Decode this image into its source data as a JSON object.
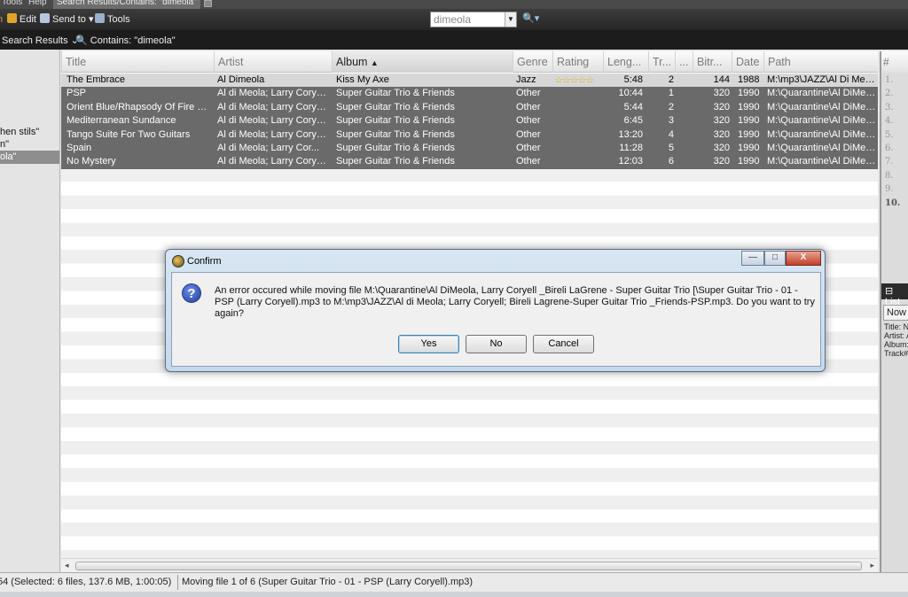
{
  "menubar": {
    "items": [
      "Tools",
      "Help"
    ],
    "active_tab": "Search Results/Contains: \"dimeola\""
  },
  "toolbar": {
    "edit": "Edit",
    "send_to": "Send to",
    "tools": "Tools",
    "search_value": "dimeola"
  },
  "breadcrumb": {
    "search_results": "Search Results",
    "contains": "Contains: \"dimeola\""
  },
  "tree": {
    "items": [
      "hen stils\"",
      "n\"",
      "ola\""
    ]
  },
  "columns": [
    "Title",
    "Artist",
    "Album",
    "Genre",
    "Rating",
    "Leng...",
    "Tr...",
    "...",
    "Bitr...",
    "Date",
    "Path"
  ],
  "tracks": [
    {
      "title": "The Embrace",
      "artist": "Al Dimeola",
      "album": "Kiss My Axe",
      "genre": "Jazz",
      "rating": "☆☆☆☆☆",
      "length": "5:48",
      "track": "2",
      "bitrate": "144",
      "date": "1988",
      "path": "M:\\mp3\\JAZZ\\Al Di Meol..."
    },
    {
      "title": "PSP",
      "artist": "Al di Meola; Larry Coryell...",
      "album": "Super Guitar Trio & Friends",
      "genre": "Other",
      "rating": "",
      "length": "10:44",
      "track": "1",
      "bitrate": "320",
      "date": "1990",
      "path": "M:\\Quarantine\\Al DiMeol..."
    },
    {
      "title": "Orient Blue/Rhapsody Of Fire (M...",
      "artist": "Al di Meola; Larry Coryell...",
      "album": "Super Guitar Trio & Friends",
      "genre": "Other",
      "rating": "",
      "length": "5:44",
      "track": "2",
      "bitrate": "320",
      "date": "1990",
      "path": "M:\\Quarantine\\Al DiMeol..."
    },
    {
      "title": "Mediterranean Sundance",
      "artist": "Al di Meola; Larry Coryell...",
      "album": "Super Guitar Trio & Friends",
      "genre": "Other",
      "rating": "",
      "length": "6:45",
      "track": "3",
      "bitrate": "320",
      "date": "1990",
      "path": "M:\\Quarantine\\Al DiMeol..."
    },
    {
      "title": "Tango Suite For Two Guitars",
      "artist": "Al di Meola; Larry Coryell...",
      "album": "Super Guitar Trio & Friends",
      "genre": "Other",
      "rating": "",
      "length": "13:20",
      "track": "4",
      "bitrate": "320",
      "date": "1990",
      "path": "M:\\Quarantine\\Al DiMeol..."
    },
    {
      "title": "Spain",
      "artist": "Al di Meola; Larry Cor...",
      "album": "Super Guitar Trio & Friends",
      "genre": "Other",
      "rating": "",
      "length": "11:28",
      "track": "5",
      "bitrate": "320",
      "date": "1990",
      "path": "M:\\Quarantine\\Al DiMeol..."
    },
    {
      "title": "No Mystery",
      "artist": "Al di Meola; Larry Coryell...",
      "album": "Super Guitar Trio & Friends",
      "genre": "Other",
      "rating": "",
      "length": "12:03",
      "track": "6",
      "bitrate": "320",
      "date": "1990",
      "path": "M:\\Quarantine\\Al DiMeol..."
    }
  ],
  "right_pane": {
    "header": "#",
    "numbers": [
      "1.",
      "2.",
      "3.",
      "4.",
      "5.",
      "6.",
      "7.",
      "8.",
      "9.",
      "10."
    ],
    "list_tab": "List",
    "now_tab": "Now P",
    "info": [
      "Title: N",
      "Artist: A",
      "Album:",
      "Track#"
    ]
  },
  "status": {
    "selection": "54 (Selected: 6 files, 137.6 MB, 1:00:05)",
    "progress": "Moving file 1 of 6 (Super Guitar Trio - 01 - PSP (Larry Coryell).mp3)"
  },
  "dialog": {
    "title": "Confirm",
    "message": "An error occured while moving file M:\\Quarantine\\Al DiMeola, Larry Coryell _Bireli LaGrene - Super Guitar Trio [\\Super Guitar Trio - 01 - PSP (Larry Coryell).mp3 to M:\\mp3\\JAZZ\\Al di Meola; Larry Coryell; Bireli Lagrene-Super Guitar Trio _Friends-PSP.mp3. Do you want to try again?",
    "yes": "Yes",
    "no": "No",
    "cancel": "Cancel",
    "minimize": "—",
    "maximize": "□",
    "close": "X"
  },
  "colors": {
    "selected_row": "#6a6a6a",
    "toolbar": "#2e2e2e",
    "dialog_frame": "#c6d9ec"
  }
}
